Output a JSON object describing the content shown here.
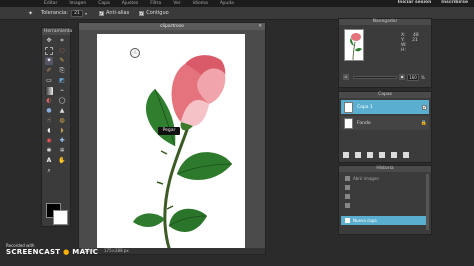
{
  "menubar": {
    "items": [
      "Editar",
      "Imagen",
      "Capa",
      "Ajustes",
      "Filtro",
      "Ver",
      "Idioma",
      "Ayuda"
    ],
    "right": [
      "Iniciar sesión",
      "Inscribirse"
    ]
  },
  "options": {
    "tolerance_label": "Tolerancia:",
    "tolerance_value": "21",
    "antialias_label": "Anti-alias",
    "contiguous_label": "Contiguo"
  },
  "tools": {
    "header": "Herramienta"
  },
  "document": {
    "title": "clipartrose",
    "status_zoom": "100 %",
    "status_size": "175×288 px",
    "tooltip": "Pegar"
  },
  "navigator": {
    "header": "Navegador",
    "x_label": "X:",
    "x_value": "48",
    "y_label": "Y:",
    "y_value": "21",
    "w_label": "W:",
    "h_label": "H:",
    "zoom_value": "160",
    "zoom_unit": "%"
  },
  "layers": {
    "header": "Capas",
    "items": [
      {
        "name": "Capa 1",
        "selected": true
      },
      {
        "name": "Fondo",
        "selected": false
      }
    ]
  },
  "history": {
    "header": "Historia",
    "items": [
      "Abrir imagen",
      "",
      "",
      "",
      "Nueva capa"
    ],
    "selected_label": "Nueva capa"
  },
  "watermark": {
    "line1": "Recorded with",
    "line2": "SCREENCAST",
    "line3": "MATIC"
  },
  "colors": {
    "accent": "#5aa7c8",
    "selected_layer": "#5aaed0",
    "rose": "#e8707a",
    "leaf": "#2d7a2d"
  }
}
